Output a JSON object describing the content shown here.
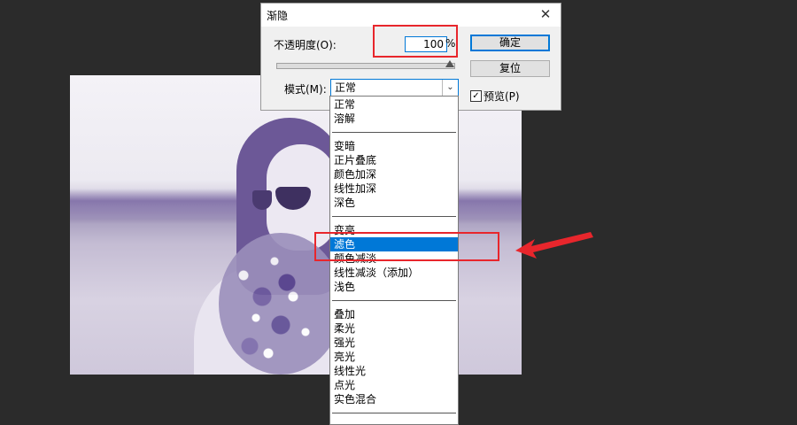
{
  "dialog": {
    "title": "渐隐",
    "close_glyph": "✕",
    "opacity_label": "不透明度(O):",
    "opacity_value": "100",
    "opacity_unit": "%",
    "opacity_slider_fraction": 1.0,
    "ok_label": "确定",
    "reset_label": "复位",
    "mode_label": "模式(M):",
    "mode_value": "正常",
    "preview_label": "预览(P)",
    "preview_checked": true,
    "preview_check_glyph": "✓",
    "dropdown_arrow_glyph": "⌄"
  },
  "dropdown": {
    "groups": [
      [
        "正常",
        "溶解"
      ],
      [
        "变暗",
        "正片叠底",
        "颜色加深",
        "线性加深",
        "深色"
      ],
      [
        "变亮",
        "滤色",
        "颜色减淡",
        "线性减淡（添加）",
        "浅色"
      ],
      [
        "叠加",
        "柔光",
        "强光",
        "亮光",
        "线性光",
        "点光",
        "实色混合"
      ]
    ],
    "highlighted": "滤色"
  },
  "colors": {
    "accent": "#0078d7",
    "annotation_red": "#e8262c",
    "canvas_bg": "#2b2b2b",
    "photo_tint": "#6c5897"
  },
  "icons": {
    "close": "close-icon",
    "dropdown": "chevron-down-icon",
    "checkbox": "checkbox-icon",
    "annotation_arrow": "arrow-icon"
  }
}
